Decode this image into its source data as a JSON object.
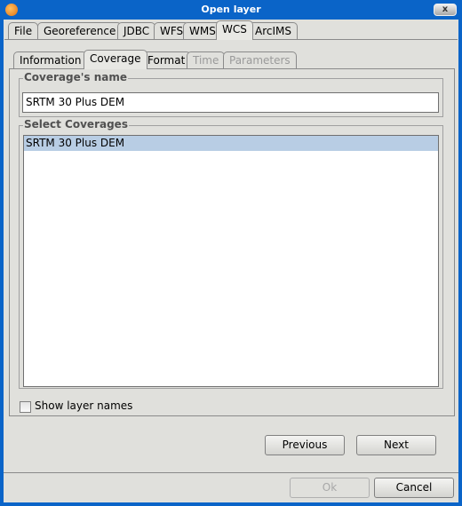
{
  "window": {
    "title": "Open layer",
    "close_label": "x"
  },
  "outer_tabs": [
    {
      "label": "File"
    },
    {
      "label": "Georeference"
    },
    {
      "label": "JDBC"
    },
    {
      "label": "WFS"
    },
    {
      "label": "WMS"
    },
    {
      "label": "WCS",
      "selected": true
    },
    {
      "label": "ArcIMS"
    }
  ],
  "inner_tabs": [
    {
      "label": "Information"
    },
    {
      "label": "Coverage",
      "selected": true
    },
    {
      "label": "Format"
    },
    {
      "label": "Time",
      "disabled": true
    },
    {
      "label": "Parameters",
      "disabled": true
    }
  ],
  "coverage_name": {
    "legend": "Coverage's name",
    "value": "SRTM 30 Plus DEM"
  },
  "select_coverages": {
    "legend": "Select Coverages",
    "items": [
      {
        "label": "SRTM 30 Plus DEM",
        "selected": true
      }
    ]
  },
  "show_layer_names": {
    "label": "Show layer names",
    "checked": false
  },
  "nav": {
    "previous": "Previous",
    "next": "Next"
  },
  "footer": {
    "ok": "Ok",
    "cancel": "Cancel",
    "ok_disabled": true
  },
  "colors": {
    "title_bar": "#0a64c8",
    "selection": "#b8cde4",
    "background": "#e0e0dc"
  }
}
